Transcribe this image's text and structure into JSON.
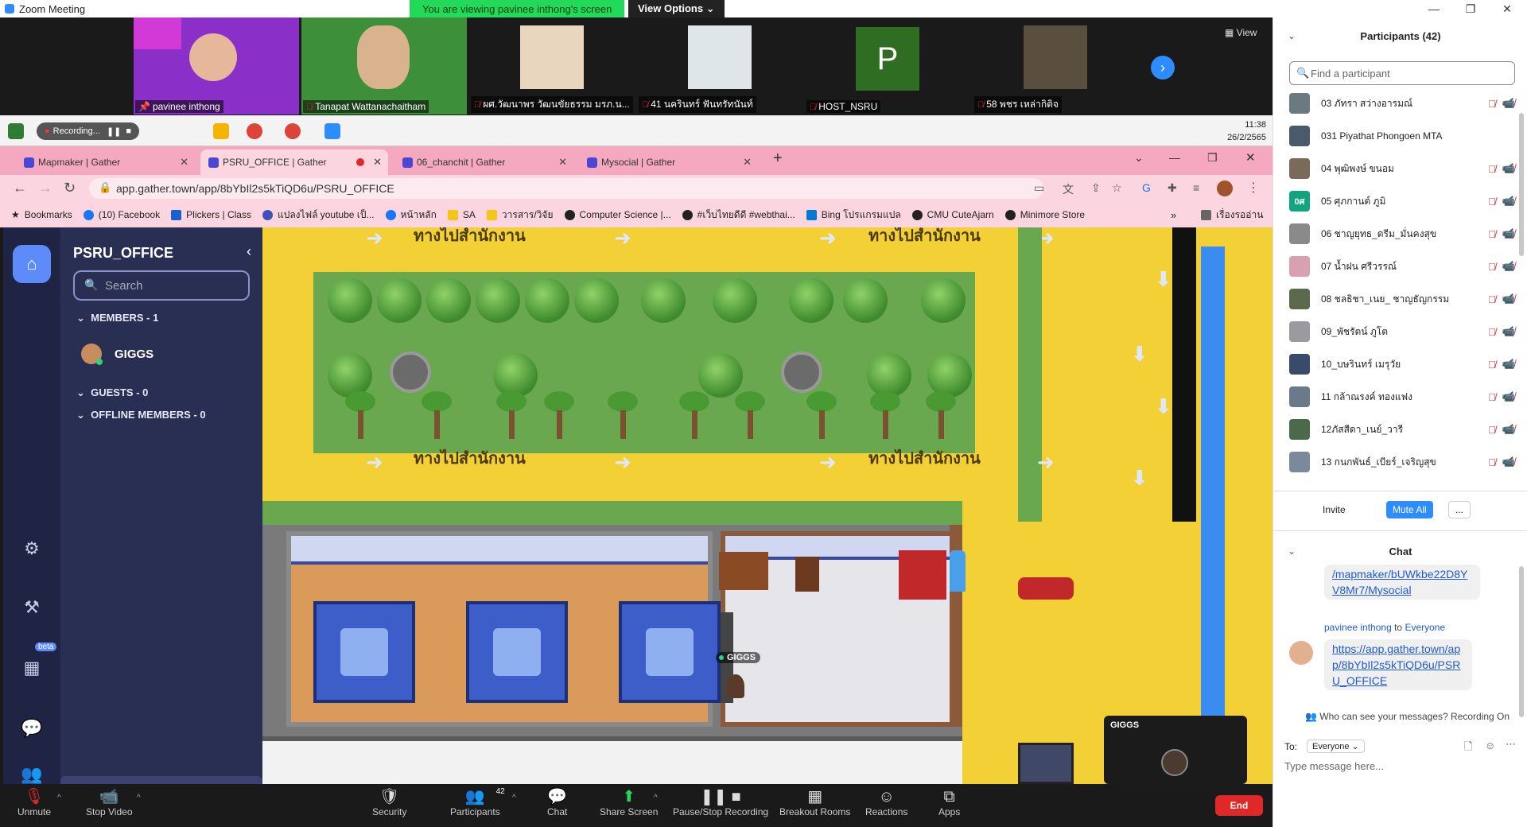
{
  "window": {
    "title": "Zoom Meeting",
    "viewing_banner": "You are viewing pavinee inthong's screen",
    "view_options": "View Options ⌄"
  },
  "gallery": {
    "view_label": "View",
    "tiles": [
      {
        "name": "pavinee inthong",
        "muted": false,
        "color": "#8b2fc9"
      },
      {
        "name": "Tanapat Wattanachaitham",
        "muted": true,
        "color": "#2f8f40"
      },
      {
        "name": "ผศ.วัฒนาพร วัฒนขัยธรรม มรภ.น...",
        "muted": true,
        "color": "#d9d2c7"
      },
      {
        "name": "41 นครินทร์ ฟันทรัทนันท์",
        "muted": true,
        "color": "#dfe6ea"
      },
      {
        "name": "HOST_NSRU",
        "muted": true,
        "color": "#2f6d22",
        "letter": "P"
      },
      {
        "name": "58 พชร เหล่ากิติจ",
        "muted": true,
        "color": "#3b3a36"
      }
    ]
  },
  "taskbar": {
    "recording": "Recording...",
    "time": "11:38",
    "date": "26/2/2565"
  },
  "browser": {
    "tabs": [
      {
        "title": "Mapmaker | Gather",
        "active": false
      },
      {
        "title": "PSRU_OFFICE | Gather",
        "active": true
      },
      {
        "title": "06_chanchit | Gather",
        "active": false
      },
      {
        "title": "Mysocial | Gather",
        "active": false
      }
    ],
    "new_tab": "+",
    "url": "app.gather.town/app/8bYbIl2s5kTiQD6u/PSRU_OFFICE",
    "bookmarks": [
      "Bookmarks",
      "(10) Facebook",
      "Plickers | Class",
      "แปลงไฟล์ youtube เป็...",
      "หน้าหลัก",
      "SA",
      "วารสาร/วิจัย",
      "Computer Science |...",
      "#เว็บไทยดีดี #webthai...",
      "Bing โปรแกรมแปล",
      "CMU CuteAjarn",
      "Minimore Store"
    ],
    "reading_list": "เรื่องรออ่าน"
  },
  "gather": {
    "room_name": "PSRU_OFFICE",
    "search_placeholder": "Search",
    "members_header": "MEMBERS - 1",
    "member_name": "GIGGS",
    "guests_header": "GUESTS - 0",
    "offline_header": "OFFLINE MEMBERS - 0",
    "beta_label": "beta",
    "map": {
      "sign_text": "ทางไปสำนักงาน",
      "avatar_label": "GIGGS"
    }
  },
  "self_video": {
    "name": "GIGGS"
  },
  "toolbar": {
    "unmute": "Unmute",
    "stop_video": "Stop Video",
    "security": "Security",
    "participants": "Participants",
    "participants_count": "42",
    "chat": "Chat",
    "share_screen": "Share Screen",
    "pause_recording": "Pause/Stop Recording",
    "breakout_rooms": "Breakout Rooms",
    "reactions": "Reactions",
    "apps": "Apps",
    "end": "End"
  },
  "participants_panel": {
    "title": "Participants (42)",
    "find_placeholder": "Find a participant",
    "list": [
      {
        "name": "03 ภัทรา สว่างอารมณ์"
      },
      {
        "name": "031 Piyathat Phongoen MTA"
      },
      {
        "name": "04 พุฒิพงษ์ ขนอม"
      },
      {
        "name": "05 ศุภกานต์ ภูมิ",
        "letter": "0ศ"
      },
      {
        "name": "06 ชาญยุทธ_ดรีม_มั่นคงสุข"
      },
      {
        "name": "07 น้ำฝน ศรีวรรณ์"
      },
      {
        "name": "08 ชลธิชา_เนย_ ชาญธัญกรรม"
      },
      {
        "name": "09_พัชรัตน์ ภูโต"
      },
      {
        "name": "10_บษรินทร์ เมรุวัย"
      },
      {
        "name": "11 กล้าณรงค์ ทองแฟง"
      },
      {
        "name": "12ภัสสีดา_เนย์_วารี"
      },
      {
        "name": "13 กนกพันธ์_เบียร์_เจริญสุข"
      }
    ],
    "invite": "Invite",
    "mute_all": "Mute All",
    "more": "..."
  },
  "chat_panel": {
    "title": "Chat",
    "prev_link": "/mapmaker/bUWkbe22D8YV8Mr7/Mysocial",
    "sender": "pavinee inthong",
    "to_word": "to",
    "recipient": "Everyone",
    "message_link": "https://app.gather.town/app/8bYbIl2s5kTiQD6u/PSRU_OFFICE",
    "visibility_note": "Who can see your messages? Recording On",
    "to_label": "To:",
    "to_select": "Everyone ⌄",
    "input_placeholder": "Type message here..."
  }
}
